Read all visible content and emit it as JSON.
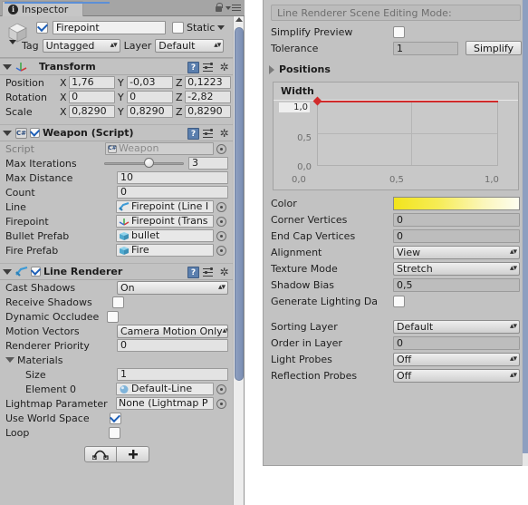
{
  "inspector": {
    "tab_label": "Inspector",
    "lock_icon": "lock-icon",
    "menu_icon": "hamburger-menu-icon",
    "object": {
      "icon": "cube-gameobject-icon",
      "enabled": true,
      "name": "Firepoint",
      "static_label": "Static",
      "static_checked": false,
      "tag_label": "Tag",
      "tag_value": "Untagged",
      "layer_label": "Layer",
      "layer_value": "Default"
    },
    "transform": {
      "title": "Transform",
      "icon": "transform-axis-icon",
      "rows": [
        {
          "label": "Position",
          "x": "1,76",
          "y": "-0,03",
          "z": "0,1223"
        },
        {
          "label": "Rotation",
          "x": "0",
          "y": "0",
          "z": "-2,82"
        },
        {
          "label": "Scale",
          "x": "0,8290",
          "y": "0,8290",
          "z": "0,8290"
        }
      ],
      "axis_x": "X",
      "axis_y": "Y",
      "axis_z": "Z"
    },
    "weapon": {
      "title": "Weapon (Script)",
      "icon": "csharp-script-icon",
      "enabled": true,
      "script_label": "Script",
      "script_value": "Weapon",
      "rows": [
        {
          "label": "Max Iterations",
          "type": "slider",
          "value": "3"
        },
        {
          "label": "Max Distance",
          "type": "number",
          "value": "10"
        },
        {
          "label": "Count",
          "type": "number",
          "value": "0"
        },
        {
          "label": "Line",
          "type": "object",
          "value": "Firepoint (Line I",
          "icon": "line-renderer-icon"
        },
        {
          "label": "Firepoint",
          "type": "object",
          "value": "Firepoint (Trans",
          "icon": "transform-axis-icon"
        },
        {
          "label": "Bullet Prefab",
          "type": "object",
          "value": "bullet",
          "icon": "prefab-cube-icon"
        },
        {
          "label": "Fire Prefab",
          "type": "object",
          "value": "Fire",
          "icon": "prefab-cube-icon"
        }
      ]
    },
    "line_renderer": {
      "title": "Line Renderer",
      "icon": "line-renderer-icon",
      "enabled": true,
      "rows": [
        {
          "label": "Cast Shadows",
          "type": "popup",
          "value": "On"
        },
        {
          "label": "Receive Shadows",
          "type": "checkbox",
          "checked": false
        },
        {
          "label": "Dynamic Occludee",
          "type": "checkbox",
          "checked": false
        },
        {
          "label": "Motion Vectors",
          "type": "popup",
          "value": "Camera Motion Only"
        },
        {
          "label": "Renderer Priority",
          "type": "number",
          "value": "0"
        }
      ],
      "materials_label": "Materials",
      "materials": [
        {
          "label": "Size",
          "type": "number",
          "value": "1"
        },
        {
          "label": "Element 0",
          "type": "object",
          "value": "Default-Line",
          "icon": "material-sphere-icon"
        }
      ],
      "lightmap_label": "Lightmap Parameter",
      "lightmap_value": "None (Lightmap P",
      "use_world_space_label": "Use World Space",
      "use_world_space_checked": true,
      "loop_label": "Loop",
      "loop_checked": false,
      "edit_points_icon": "edit-curve-points-icon",
      "add_point_icon": "plus-icon"
    }
  },
  "scene_editing": {
    "help_text": "Line Renderer Scene Editing Mode:",
    "simplify_preview_label": "Simplify Preview",
    "simplify_preview_checked": false,
    "tolerance_label": "Tolerance",
    "tolerance_value": "1",
    "simplify_button": "Simplify",
    "positions_label": "Positions",
    "positions_expanded": false,
    "rows": [
      {
        "label": "Color",
        "type": "gradient"
      },
      {
        "label": "Corner Vertices",
        "type": "number",
        "value": "0"
      },
      {
        "label": "End Cap Vertices",
        "type": "number",
        "value": "0"
      },
      {
        "label": "Alignment",
        "type": "popup",
        "value": "View"
      },
      {
        "label": "Texture Mode",
        "type": "popup",
        "value": "Stretch"
      },
      {
        "label": "Shadow Bias",
        "type": "number",
        "value": "0,5"
      },
      {
        "label": "Generate Lighting Da",
        "type": "checkbox",
        "checked": false
      }
    ],
    "rows2": [
      {
        "label": "Sorting Layer",
        "type": "popup",
        "value": "Default"
      },
      {
        "label": "Order in Layer",
        "type": "number",
        "value": "0"
      },
      {
        "label": "Light Probes",
        "type": "popup",
        "value": "Off"
      },
      {
        "label": "Reflection Probes",
        "type": "popup",
        "value": "Off"
      }
    ]
  },
  "chart_data": {
    "type": "line",
    "title": "Width",
    "xlabel": "",
    "ylabel": "",
    "x": [
      0.0,
      1.0
    ],
    "values": [
      1.0,
      1.0
    ],
    "xlim": [
      0.0,
      1.0
    ],
    "ylim": [
      0.0,
      1.0
    ],
    "x_ticks": [
      "0,0",
      "0,5",
      "1,0"
    ],
    "y_ticks": [
      "0,0",
      "0,5",
      "1,0"
    ],
    "grid": true,
    "legend": "none",
    "curve_color": "#d12b2b",
    "keyframes": [
      {
        "time": 0.0,
        "value": 1.0
      }
    ]
  },
  "colors": {
    "panel_bg": "#c2c2c2",
    "accent_blue": "#5c8fd6",
    "curve_red": "#d12b2b",
    "gradient_start": "#f2e41d",
    "gradient_end": "#fdfdf0",
    "scrollbar": "#8d9fc0"
  }
}
